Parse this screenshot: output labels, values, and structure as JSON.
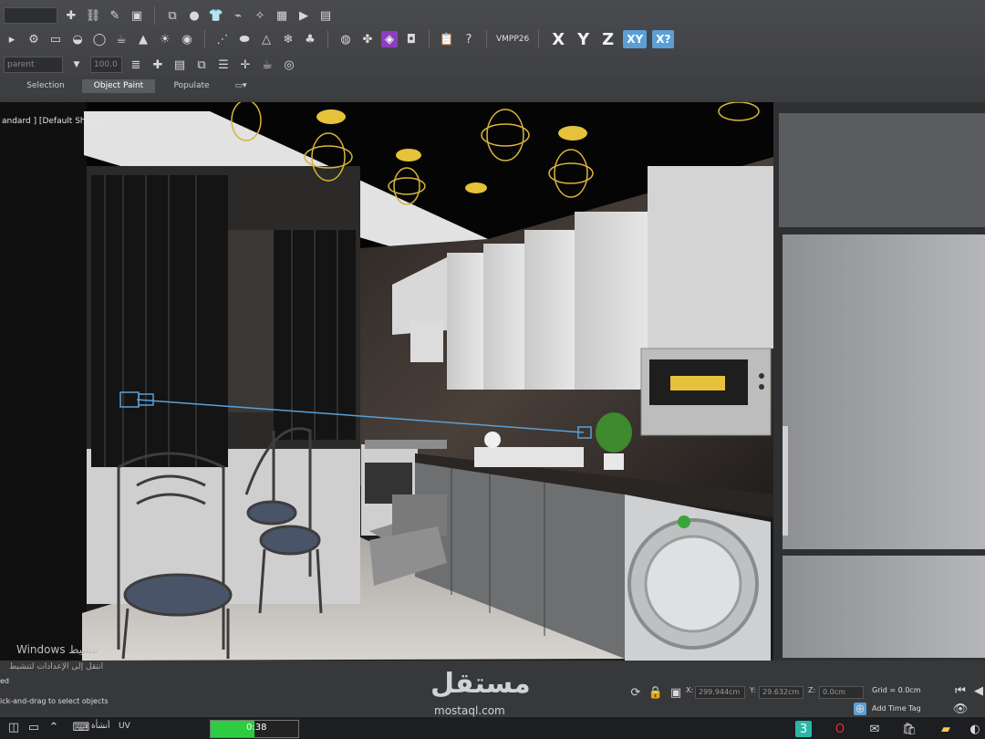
{
  "toolbar": {
    "vmpp_label": "VMPP26",
    "axis_x": "X",
    "axis_y": "Y",
    "axis_z": "Z",
    "axis_xy": "XY",
    "axis_xy2": "X?",
    "layer_value": "parent",
    "spin_value": "100.0"
  },
  "tabs": [
    {
      "label": "Selection"
    },
    {
      "label": "Object Paint"
    },
    {
      "label": "Populate"
    }
  ],
  "viewport": {
    "label": "andard ] [Default Shadin"
  },
  "status": {
    "watermark_title": "Windows تنشيط",
    "watermark_sub": "انتقل إلى الإعدادات لتنشيط",
    "line1": "ed",
    "line2": "ick-and-drag to select objects",
    "x_label": "X:",
    "x_value": "299.944cm",
    "y_label": "Y:",
    "y_value": "29.632cm",
    "z_label": "Z:",
    "z_value": "0.0cm",
    "grid": "Grid = 0.0cm",
    "add_time_tag": "Add Time Tag"
  },
  "brand": {
    "arabic": "مستقل",
    "latin": "mostaql.com"
  },
  "taskbar": {
    "timer": "0:38",
    "lang": "UV",
    "lang2": "أنشأة"
  },
  "colors": {
    "accent": "#5b9fd6",
    "progress": "#2ecc40",
    "gold": "#e6c13a"
  }
}
